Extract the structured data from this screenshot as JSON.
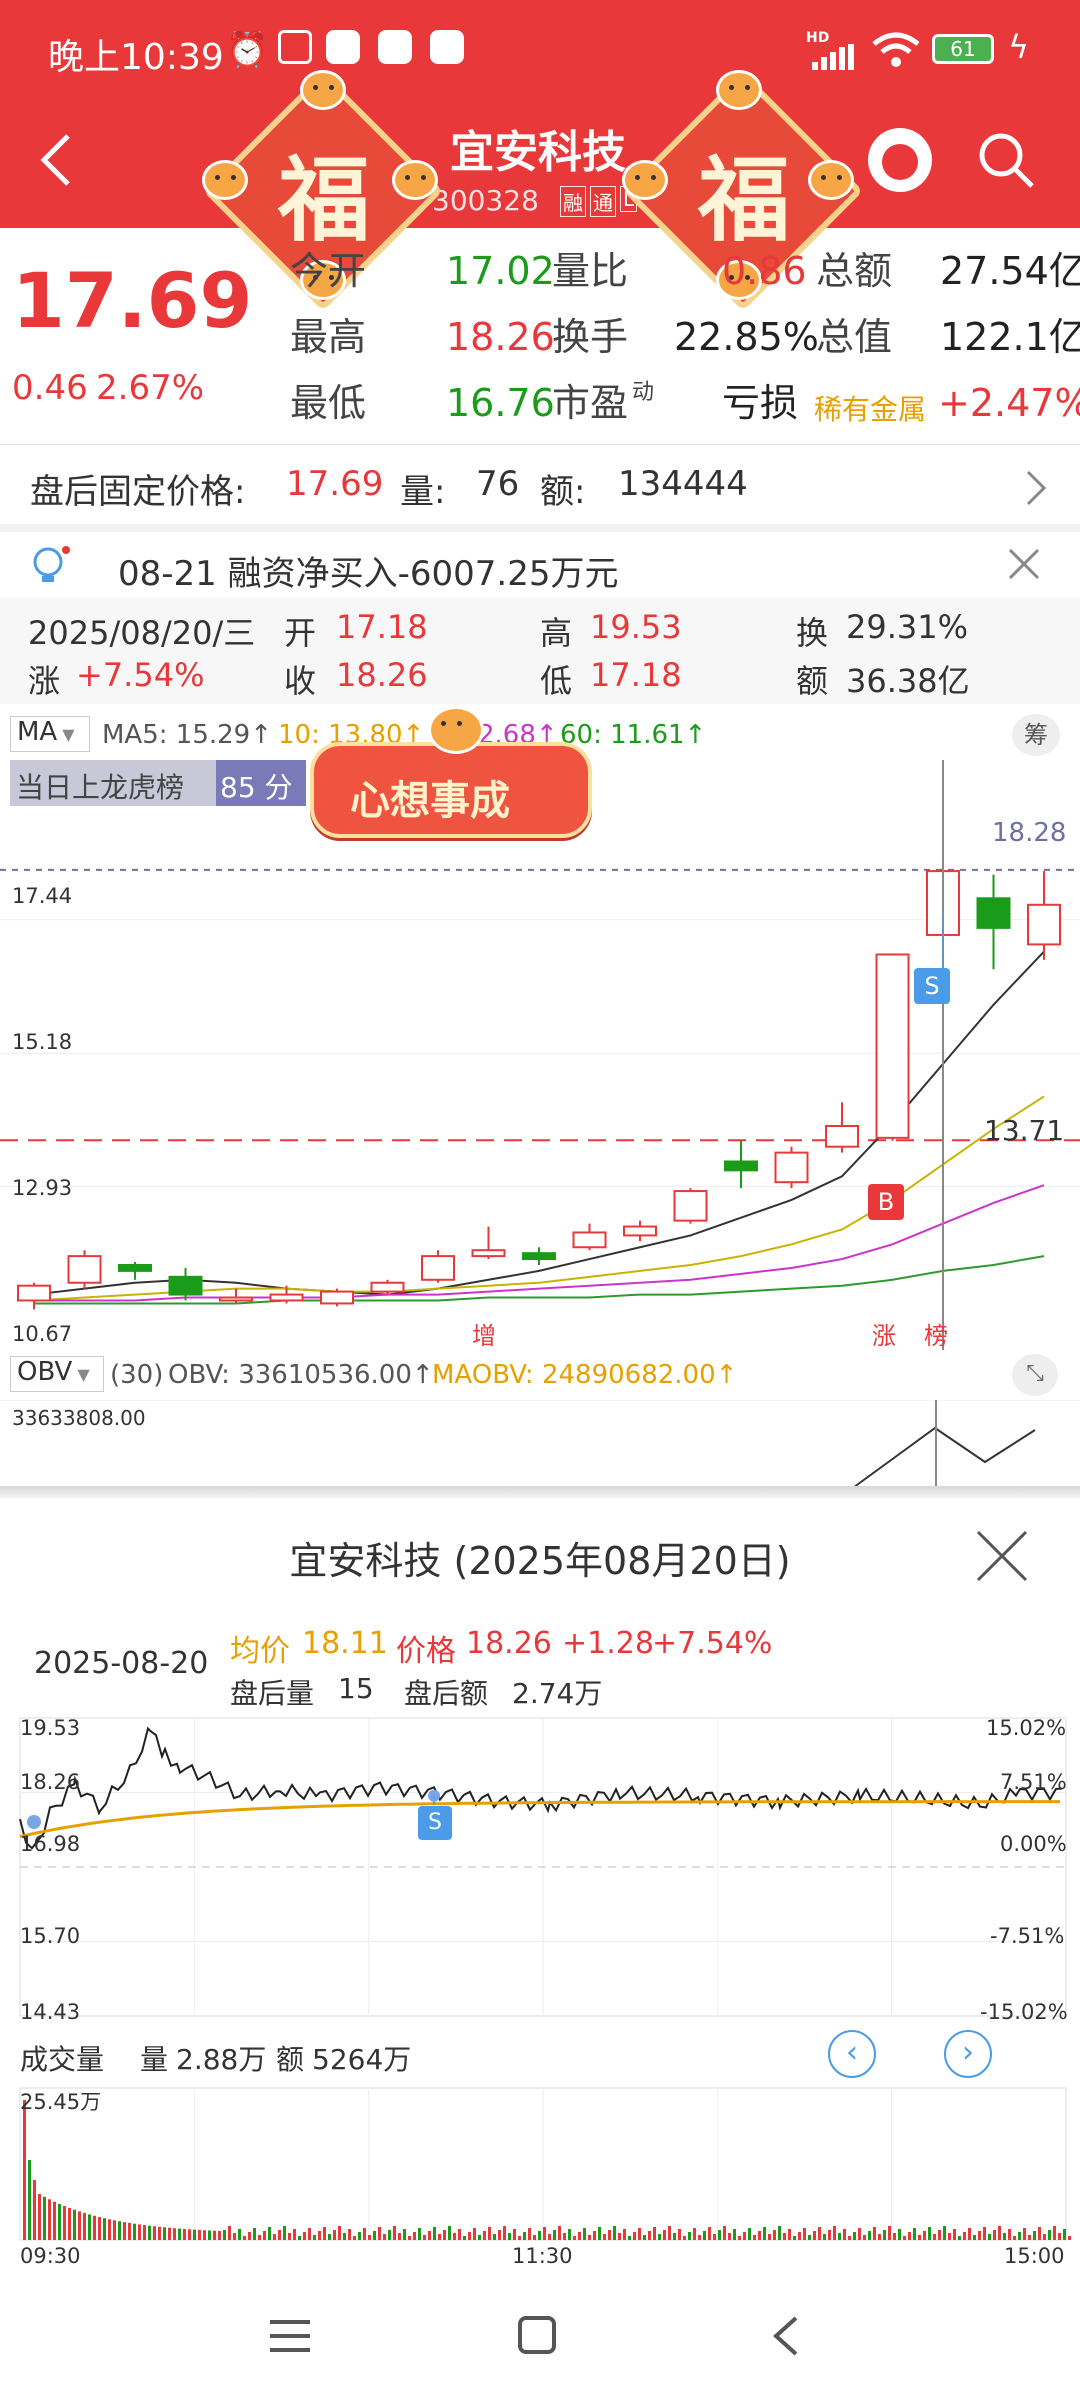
{
  "status_bar": {
    "time": "晚上10:39",
    "battery": "61",
    "network": "HD"
  },
  "header": {
    "title": "宜安科技",
    "code": "300328",
    "tags": [
      "融",
      "通",
      "L"
    ],
    "festive_text": "福"
  },
  "quote": {
    "price": "17.69",
    "change": "0.46",
    "change_pct": "2.67%",
    "rows": [
      {
        "l1": "今开",
        "v1": "17.02",
        "l2": "量比",
        "v2": "0.86",
        "l3": "总额",
        "v3": "27.54亿"
      },
      {
        "l1": "最高",
        "v1": "18.26",
        "l2": "换手",
        "v2": "22.85%",
        "l3": "总值",
        "v3": "122.1亿"
      },
      {
        "l1": "最低",
        "v1": "16.76",
        "l2": "市盈",
        "v2": "亏损",
        "l3": "稀有金属",
        "v3": "+2.47%"
      }
    ],
    "pe_superscript": "动"
  },
  "after_hours": {
    "label": "盘后固定价格:",
    "price": "17.69",
    "vol_label": "量:",
    "vol": "76",
    "amt_label": "额:",
    "amt": "134444"
  },
  "news": {
    "text": "08-21 融资净买入-6007.25万元"
  },
  "day_info": {
    "date": "2025/08/20/三",
    "open_l": "开",
    "open": "17.18",
    "high_l": "高",
    "high": "19.53",
    "turn_l": "换",
    "turn": "29.31%",
    "chg_l": "涨",
    "chg": "+7.54%",
    "close_l": "收",
    "close": "18.26",
    "low_l": "低",
    "low": "17.18",
    "amt_l": "额",
    "amt": "36.38亿"
  },
  "ma_bar": {
    "selector": "MA",
    "ma5": "MA5: 15.29↑",
    "ma10": "10: 13.80↑",
    "ma30": "2.68↑",
    "ma60": "60: 11.61↑",
    "chip": "筹"
  },
  "longhu": {
    "label": "当日上龙虎榜",
    "count": "85 分2笔"
  },
  "sticker": {
    "text": "心想事成"
  },
  "kline": {
    "y_labels": [
      "18.28",
      "17.44",
      "15.18",
      "13.71",
      "12.93",
      "10.67"
    ],
    "markers": [
      "S",
      "B"
    ],
    "bottom_tags": [
      "增",
      "涨",
      "榜"
    ]
  },
  "kline_candles": [
    {
      "o": 11.0,
      "c": 11.25,
      "h": 11.3,
      "l": 10.85
    },
    {
      "o": 11.3,
      "c": 11.75,
      "h": 11.85,
      "l": 11.2
    },
    {
      "o": 11.6,
      "c": 11.5,
      "h": 11.65,
      "l": 11.35
    },
    {
      "o": 11.4,
      "c": 11.1,
      "h": 11.55,
      "l": 11.0
    },
    {
      "o": 11.0,
      "c": 11.05,
      "h": 11.2,
      "l": 10.95
    },
    {
      "o": 11.0,
      "c": 11.1,
      "h": 11.25,
      "l": 10.95
    },
    {
      "o": 10.95,
      "c": 11.15,
      "h": 11.2,
      "l": 10.9
    },
    {
      "o": 11.15,
      "c": 11.3,
      "h": 11.35,
      "l": 11.1
    },
    {
      "o": 11.35,
      "c": 11.75,
      "h": 11.85,
      "l": 11.3
    },
    {
      "o": 11.75,
      "c": 11.85,
      "h": 12.25,
      "l": 11.7
    },
    {
      "o": 11.8,
      "c": 11.7,
      "h": 11.9,
      "l": 11.6
    },
    {
      "o": 11.9,
      "c": 12.15,
      "h": 12.3,
      "l": 11.85
    },
    {
      "o": 12.1,
      "c": 12.25,
      "h": 12.35,
      "l": 12.0
    },
    {
      "o": 12.35,
      "c": 12.85,
      "h": 12.9,
      "l": 12.3
    },
    {
      "o": 13.35,
      "c": 13.2,
      "h": 13.7,
      "l": 12.9
    },
    {
      "o": 13.0,
      "c": 13.5,
      "h": 13.6,
      "l": 12.9
    },
    {
      "o": 13.6,
      "c": 13.95,
      "h": 14.35,
      "l": 13.5
    },
    {
      "o": 13.75,
      "c": 16.85,
      "h": 16.85,
      "l": 13.7
    },
    {
      "o": 17.18,
      "c": 18.26,
      "h": 19.53,
      "l": 17.18
    },
    {
      "o": 17.8,
      "c": 17.3,
      "h": 18.2,
      "l": 16.6
    },
    {
      "o": 17.02,
      "c": 17.69,
      "h": 18.26,
      "l": 16.76
    }
  ],
  "ma5_line": [
    11.1,
    11.2,
    11.3,
    11.35,
    11.3,
    11.2,
    11.15,
    11.1,
    11.2,
    11.35,
    11.5,
    11.7,
    11.9,
    12.1,
    12.4,
    12.7,
    13.1,
    14.0,
    15.0,
    16.0,
    16.9
  ],
  "ma10_line": [
    11.0,
    11.05,
    11.1,
    11.15,
    11.2,
    11.2,
    11.15,
    11.15,
    11.2,
    11.25,
    11.3,
    11.4,
    11.5,
    11.6,
    11.75,
    11.95,
    12.2,
    12.7,
    13.3,
    13.9,
    14.45
  ],
  "ma30_line": [
    11.0,
    11.0,
    11.0,
    11.05,
    11.05,
    11.05,
    11.05,
    11.1,
    11.1,
    11.15,
    11.2,
    11.25,
    11.3,
    11.35,
    11.45,
    11.55,
    11.7,
    11.95,
    12.3,
    12.65,
    12.95
  ],
  "ma60_line": [
    10.95,
    10.95,
    10.95,
    10.95,
    10.95,
    11.0,
    11.0,
    11.0,
    11.0,
    11.05,
    11.05,
    11.05,
    11.1,
    11.1,
    11.15,
    11.2,
    11.25,
    11.35,
    11.5,
    11.6,
    11.75
  ],
  "obv": {
    "selector": "OBV",
    "period": "(30)",
    "value": "OBV: 33610536.00↑",
    "ma": "MAOBV: 24890682.00↑",
    "y_label": "33633808.00"
  },
  "popup": {
    "title": "宜安科技 (2025年08月20日)",
    "date": "2025-08-20",
    "avg_label": "均价",
    "avg": "18.11",
    "price_label": "价格",
    "price": "18.26",
    "chg": "+1.28",
    "chg_pct": "+7.54%",
    "ah_vol_label": "盘后量",
    "ah_vol": "15",
    "ah_amt_label": "盘后额",
    "ah_amt": "2.74万",
    "y_left": [
      "19.53",
      "18.26",
      "16.98",
      "15.70",
      "14.43"
    ],
    "y_right": [
      "15.02%",
      "7.51%",
      "0.00%",
      "-7.51%",
      "-15.02%"
    ],
    "marker": "S",
    "vol_title": "成交量",
    "vol_label": "量",
    "vol": "2.88万",
    "amt_label": "额",
    "amt": "5264万",
    "vol_max": "25.45万",
    "x_labels": [
      "09:30",
      "11:30",
      "15:00"
    ]
  },
  "colors": {
    "brand_red": "#e8383a",
    "green": "#1a9b1a",
    "orange": "#e8a000",
    "magenta": "#cc33cc",
    "ma_green": "#2e9a2e"
  }
}
